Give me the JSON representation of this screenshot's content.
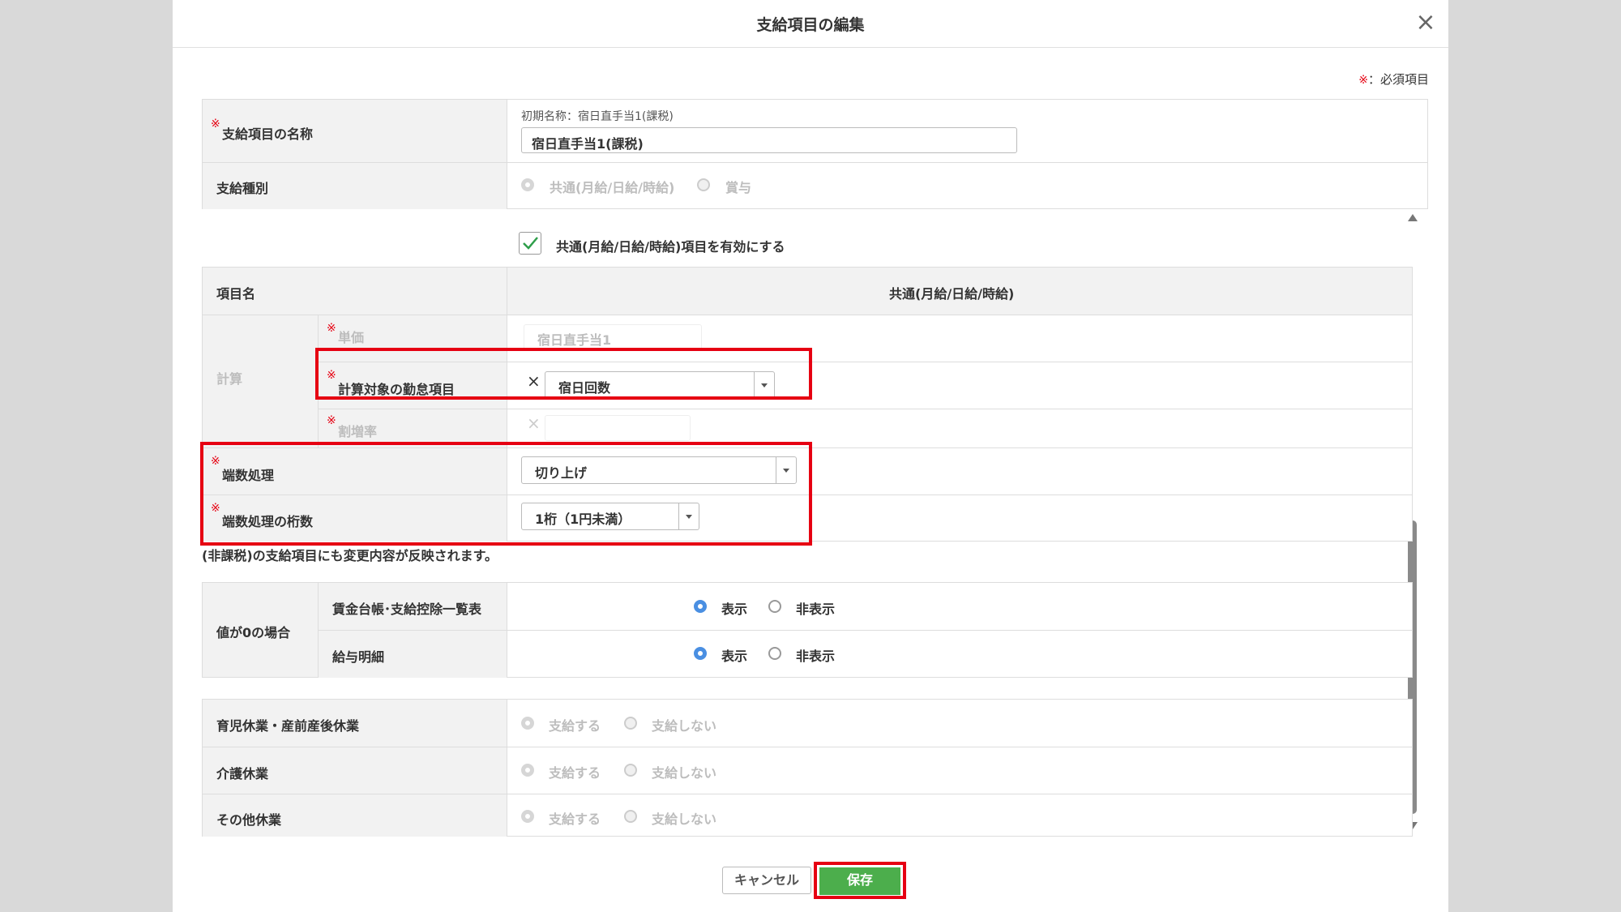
{
  "modal": {
    "title": "支給項目の編集",
    "close_icon": "close-icon"
  },
  "required_note": {
    "mark": "※",
    "text": "：必須項目"
  },
  "required_mark": "※",
  "item_name": {
    "label": "支給項目の名称",
    "initial_hint": "初期名称：宿日直手当1(課税)",
    "value": "宿日直手当1(課税)"
  },
  "pay_type": {
    "label": "支給種別",
    "options": [
      "共通(月給/日給/時給)",
      "賞与"
    ]
  },
  "enable_checkbox": {
    "label": "共通(月給/日給/時給)項目を有効にする",
    "checked": true
  },
  "grid": {
    "header_left": "項目名",
    "header_right": "共通(月給/日給/時給)",
    "calc_group": "計算",
    "unit_price": {
      "label": "単価",
      "value": "宿日直手当1"
    },
    "attendance_item": {
      "label": "計算対象の勤怠項目",
      "value": "宿日回数"
    },
    "premium_rate": {
      "label": "割増率"
    },
    "rounding": {
      "label": "端数処理",
      "value": "切り上げ"
    },
    "rounding_digits": {
      "label": "端数処理の桁数",
      "value": "1桁（1円未満）"
    }
  },
  "notice": "(非課税)の支給項目にも変更内容が反映されます。",
  "zero_value": {
    "group": "値が0の場合",
    "rows": [
      {
        "label": "賃金台帳･支給控除一覧表",
        "options": [
          "表示",
          "非表示"
        ],
        "selected": "表示"
      },
      {
        "label": "給与明細",
        "options": [
          "表示",
          "非表示"
        ],
        "selected": "表示"
      }
    ]
  },
  "leave": {
    "rows": [
      {
        "label": "育児休業・産前産後休業",
        "options": [
          "支給する",
          "支給しない"
        ]
      },
      {
        "label": "介護休業",
        "options": [
          "支給する",
          "支給しない"
        ]
      },
      {
        "label": "その他休業",
        "options": [
          "支給する",
          "支給しない"
        ]
      }
    ]
  },
  "buttons": {
    "cancel": "キャンセル",
    "save": "保存"
  },
  "colors": {
    "highlight": "#e60012",
    "save": "#4cae4c",
    "radio_on": "#4a8fe2",
    "checkbox": "#2e9e4a"
  }
}
